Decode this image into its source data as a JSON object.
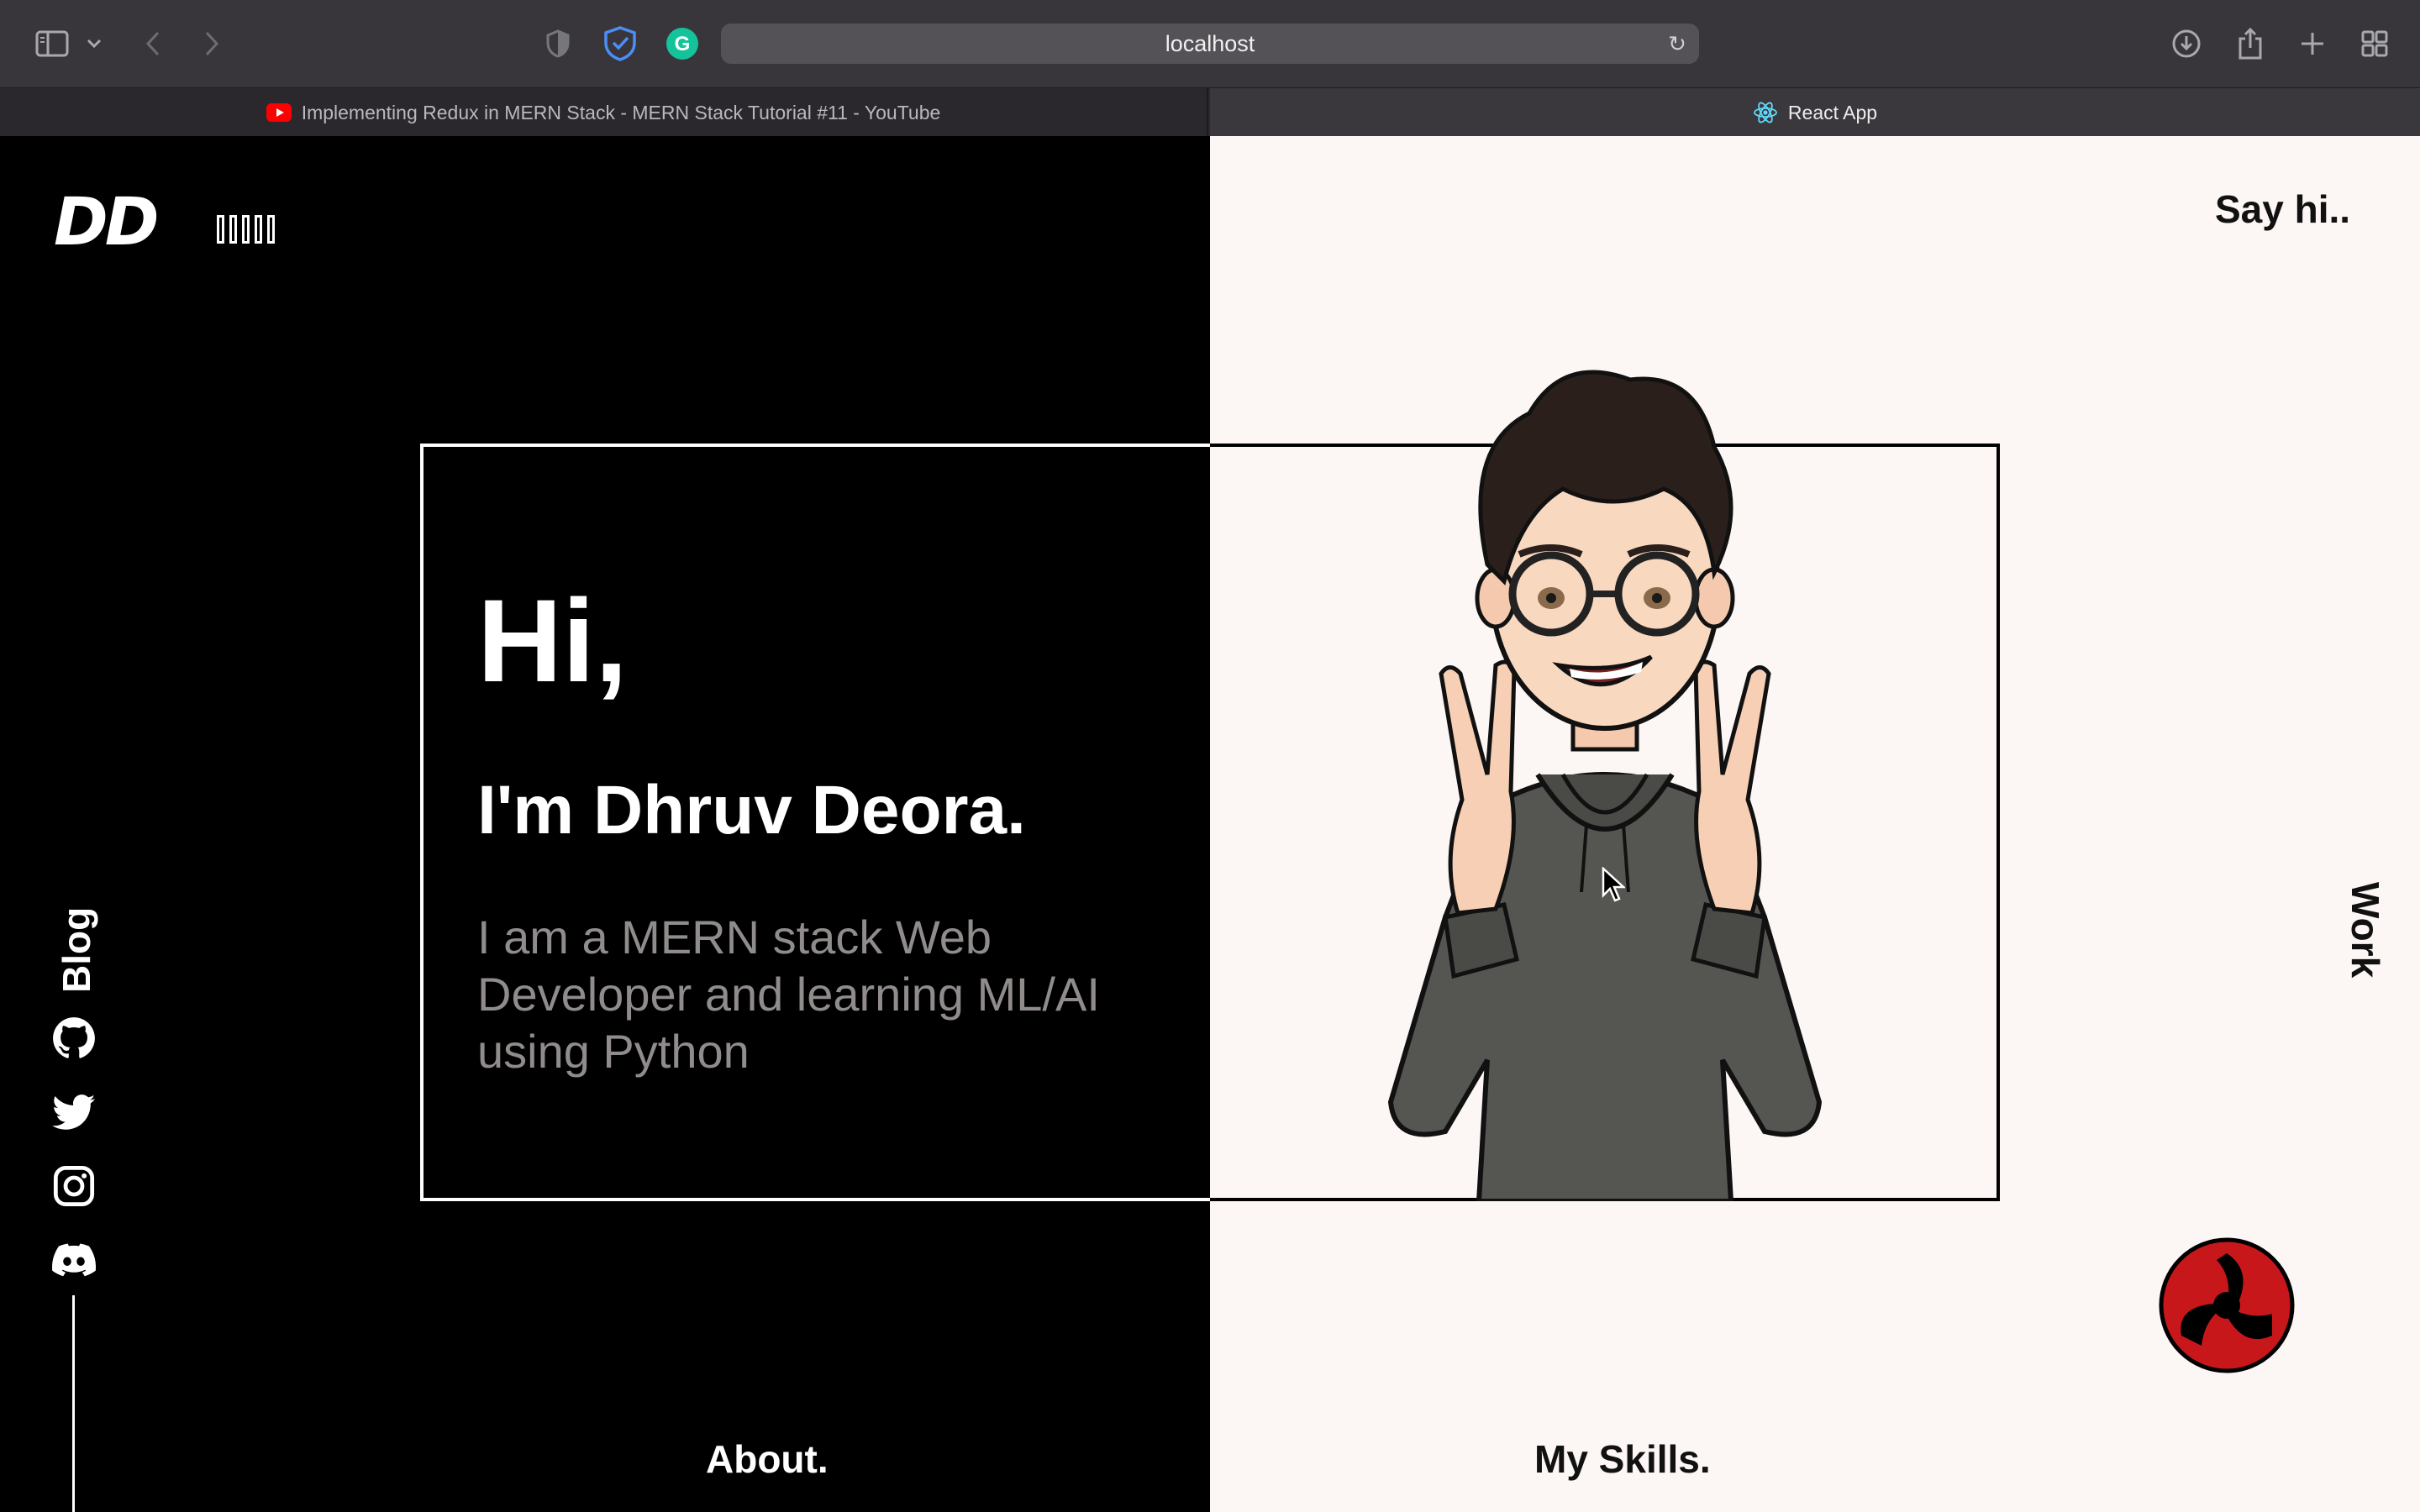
{
  "browser": {
    "url": "localhost",
    "tabs": [
      {
        "label": "Implementing Redux in MERN Stack - MERN Stack Tutorial #11 - YouTube",
        "active": false
      },
      {
        "label": "React App",
        "active": true
      }
    ]
  },
  "site": {
    "logo": "DD",
    "menu_glyphs": "▯▯▯▯▯",
    "say_hi": "Say hi..",
    "blog": "Blog",
    "work": "Work",
    "about": "About.",
    "skills": "My Skills.",
    "hero": {
      "greeting": "Hi,",
      "name": "I'm Dhruv Deora.",
      "description": "I am a MERN stack Web Developer and learning ML/AI using Python"
    },
    "social_icons": [
      "github-icon",
      "twitter-icon",
      "instagram-icon",
      "discord-icon"
    ],
    "theme": {
      "dark": "#000000",
      "light": "#fcf6f4",
      "accent": "#c8171b"
    }
  }
}
